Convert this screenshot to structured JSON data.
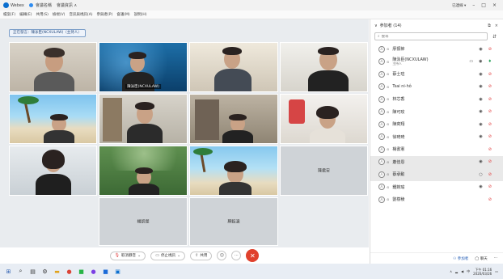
{
  "titlebar": {
    "app_name": "Webex",
    "meeting_title": "會議名稱",
    "info_label": "會議資訊 ∧",
    "user_label": "已連線 ▾",
    "min": "–",
    "max": "□",
    "close": "×"
  },
  "menu": [
    "檔案(F)",
    "編輯(E)",
    "共用(S)",
    "檢視(V)",
    "音訊與視訊(A)",
    "參與者(P)",
    "會議(M)",
    "說明(H)"
  ],
  "speaker_label": "正在發言：陳泳臣(NCXULAW)（主持人）",
  "tiles": {
    "t4_name": "陳泳臣(NCXULAW)",
    "t12_name": "陳君安",
    "t14_name": "楊凱傑",
    "t15_name": "顏鈺涵"
  },
  "controls": {
    "unmute": "取消靜音",
    "stop_video": "停止視訊",
    "share": "共用",
    "more": "···",
    "end": "✕"
  },
  "panel": {
    "title": "參加者 (14)",
    "search_placeholder": "搜尋",
    "participants": [
      {
        "name": "廖振節",
        "sub": "",
        "icons": [
          "eye",
          "mic-off"
        ]
      },
      {
        "name": "陳泳臣(NCXULAW)",
        "sub": "主持人",
        "icons": [
          "cam",
          "eye",
          "mic-on"
        ]
      },
      {
        "name": "蔡士瑄",
        "sub": "",
        "icons": [
          "eye",
          "mic-off"
        ]
      },
      {
        "name": "Tsai ni-hô",
        "sub": "",
        "icons": [
          "eye",
          "mic-off"
        ]
      },
      {
        "name": "林芯香",
        "sub": "",
        "icons": [
          "eye",
          "mic-off"
        ]
      },
      {
        "name": "陳可玫",
        "sub": "",
        "icons": [
          "eye",
          "mic-off"
        ]
      },
      {
        "name": "陳奕翔",
        "sub": "",
        "icons": [
          "eye",
          "mic-off"
        ]
      },
      {
        "name": "徐琦琦",
        "sub": "",
        "icons": [
          "eye",
          "mic-off"
        ]
      },
      {
        "name": "楊書憲",
        "sub": "",
        "icons": [
          "mic-off"
        ]
      },
      {
        "name": "蕭佳恩",
        "sub": "",
        "icons": [
          "eye",
          "mic-off"
        ]
      },
      {
        "name": "蔡承勳",
        "sub": "",
        "icons": [
          "eye-o",
          "mic-off"
        ]
      },
      {
        "name": "鍾婉瑜",
        "sub": "",
        "icons": [
          "eye",
          "mic-off"
        ]
      },
      {
        "name": "劉樹稜",
        "sub": "",
        "icons": [
          "mic-off"
        ]
      }
    ],
    "footer_participants": "參加者",
    "footer_chat": "聊天"
  },
  "taskbar": {
    "time": "下午 01:16",
    "date": "2020/03/26"
  },
  "colors": {
    "accent": "#2b63b8",
    "end_call": "#e0412d",
    "muted": "#e23b3b",
    "unmuted": "#2aa05a"
  }
}
